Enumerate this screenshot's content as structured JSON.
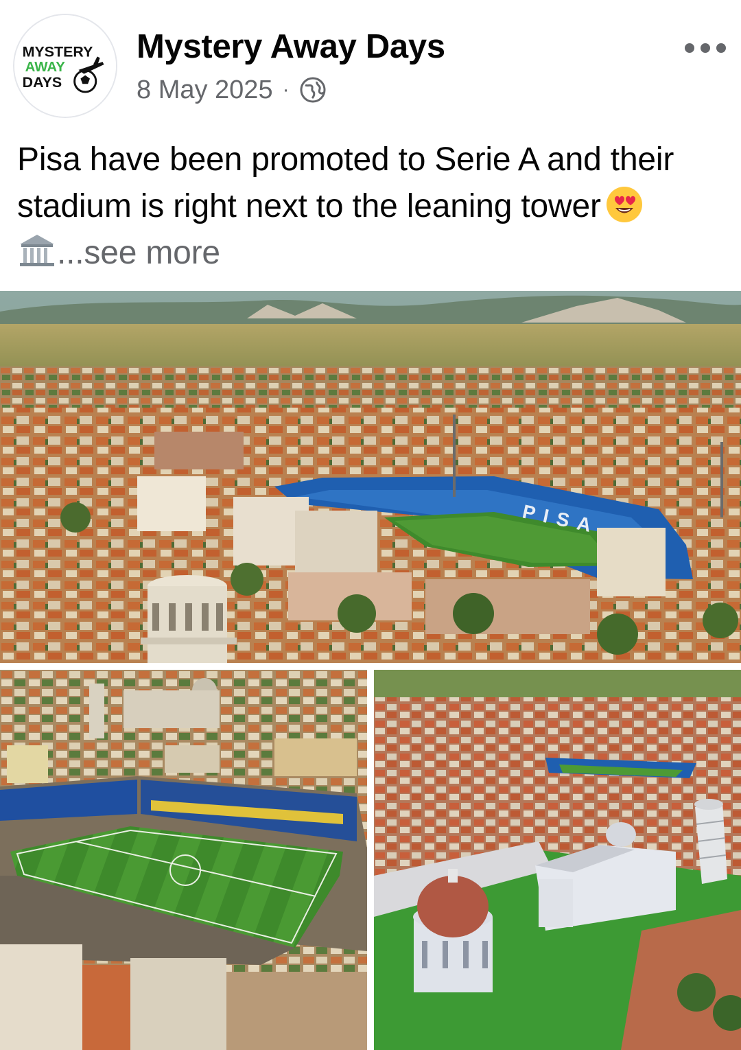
{
  "post": {
    "page_name": "Mystery Away Days",
    "date": "8 May 2025",
    "separator": "·",
    "privacy_icon": "globe-icon",
    "more_icon": "more-options-icon",
    "logo": {
      "line1": "MYSTERY",
      "line2": "AWAY",
      "line3": "DAYS"
    },
    "caption": {
      "line1": "Pisa have been promoted to Serie A and their",
      "line2": "stadium is right next to the leaning tower",
      "line3_emoji": "classical-building-emoji",
      "heart_emoji": "heart-eyes-emoji",
      "see_more": "...see more"
    },
    "photos": {
      "main": {
        "stand_lettering": "PISA"
      },
      "left": {},
      "right": {}
    }
  },
  "colors": {
    "name_text": "#050505",
    "meta_text": "#65676b",
    "logo_green": "#3bb54a",
    "pitch_green": "#3f8a2c",
    "stand_blue": "#1f5fb0",
    "roof_terracotta": "#c8693a"
  }
}
